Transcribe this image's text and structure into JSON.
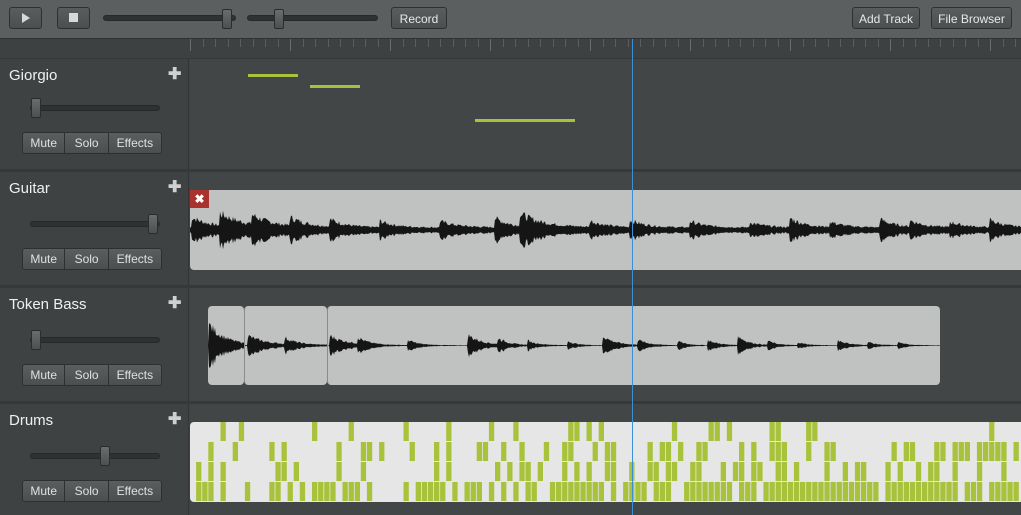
{
  "toolbar": {
    "play_icon": "play-icon",
    "stop_icon": "stop-icon",
    "record_label": "Record",
    "add_track_label": "Add Track",
    "file_browser_label": "File Browser",
    "master_volume": 0.98,
    "master_pan": 0.24
  },
  "colors": {
    "accent": "#a9c23c",
    "playhead": "#3a8fd6",
    "region": "#c0c1c1",
    "drum_bg": "#e6e6e6",
    "remove": "#a8332e"
  },
  "tracks": [
    {
      "name": "Giorgio",
      "volume": 0.03,
      "mute_label": "Mute",
      "solo_label": "Solo",
      "effects_label": "Effects",
      "add_icon": "plus-icon"
    },
    {
      "name": "Guitar",
      "volume": 0.97,
      "mute_label": "Mute",
      "solo_label": "Solo",
      "effects_label": "Effects",
      "add_icon": "plus-icon"
    },
    {
      "name": "Token Bass",
      "volume": 0.03,
      "mute_label": "Mute",
      "solo_label": "Solo",
      "effects_label": "Effects",
      "add_icon": "plus-icon"
    },
    {
      "name": "Drums",
      "volume": 0.6,
      "mute_label": "Mute",
      "solo_label": "Solo",
      "effects_label": "Effects",
      "add_icon": "plus-icon"
    }
  ],
  "guitar_region": {
    "remove_icon": "close-icon"
  }
}
